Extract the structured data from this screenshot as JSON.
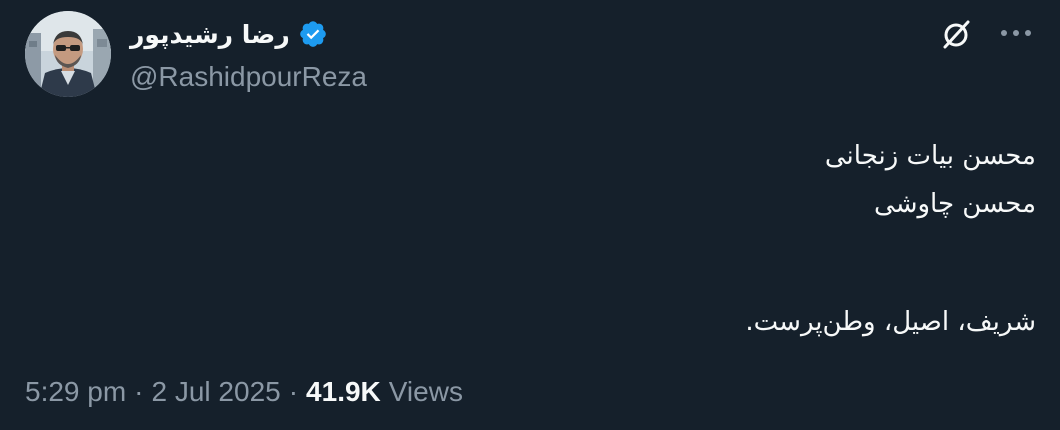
{
  "author": {
    "display_name": "رضا رشیدپور",
    "handle": "@RashidpourReza",
    "verified": true
  },
  "icons": {
    "avatar": "profile-photo",
    "verified": "verified-badge-icon",
    "grok": "grok-icon",
    "more": "more-options-icon"
  },
  "colors": {
    "background": "#15202b",
    "primary_text": "#f7f9f9",
    "secondary_text": "#8b98a5",
    "verified_blue": "#1d9bf0"
  },
  "tweet": {
    "lines": [
      "محسن بیات زنجانی",
      "محسن چاوشی",
      "شریف، اصیل، وطن‌پرست."
    ]
  },
  "meta": {
    "time": "5:29 pm",
    "separator1": "·",
    "date": "2 Jul 2025",
    "separator2": "·",
    "views_count": "41.9K",
    "views_label": "Views"
  }
}
